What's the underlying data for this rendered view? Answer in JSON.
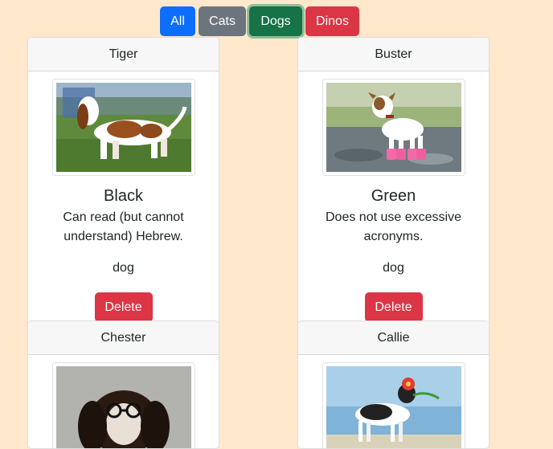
{
  "filters": {
    "all": "All",
    "cats": "Cats",
    "dogs": "Dogs",
    "dinos": "Dinos"
  },
  "cards": [
    {
      "title": "Tiger",
      "image": "photo-basset-hound",
      "name": "Black",
      "description": "Can read (but cannot understand) Hebrew.",
      "type": "dog",
      "delete_label": "Delete"
    },
    {
      "title": "Buster",
      "image": "photo-jack-russell-pink-boots",
      "name": "Green",
      "description": "Does not use excessive acronyms.",
      "type": "dog",
      "delete_label": "Delete"
    },
    {
      "title": "Chester",
      "image": "photo-spaniel-with-glasses"
    },
    {
      "title": "Callie",
      "image": "photo-dog-with-flower"
    }
  ],
  "colors": {
    "background": "#ffe8cc",
    "primary": "#0d6efd",
    "secondary": "#6c757d",
    "success": "#157347",
    "danger": "#dc3545"
  }
}
